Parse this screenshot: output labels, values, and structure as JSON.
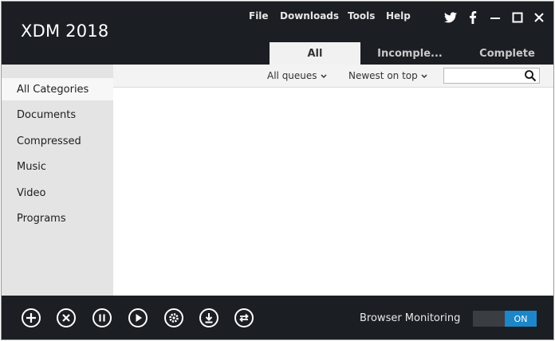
{
  "app": {
    "title": "XDM 2018"
  },
  "menu": {
    "file": "File",
    "downloads": "Downloads",
    "tools": "Tools",
    "help": "Help"
  },
  "window_controls": [
    "twitter-icon",
    "facebook-icon",
    "minimize-icon",
    "maximize-icon",
    "close-icon"
  ],
  "tabs": [
    {
      "label": "All",
      "active": true
    },
    {
      "label": "Incomple...",
      "active": false
    },
    {
      "label": "Complete",
      "active": false
    }
  ],
  "sidebar": {
    "categories": [
      {
        "label": "All Categories",
        "selected": true
      },
      {
        "label": "Documents",
        "selected": false
      },
      {
        "label": "Compressed",
        "selected": false
      },
      {
        "label": "Music",
        "selected": false
      },
      {
        "label": "Video",
        "selected": false
      },
      {
        "label": "Programs",
        "selected": false
      }
    ]
  },
  "filters": {
    "queue": "All queues",
    "sort": "Newest on top",
    "search_value": ""
  },
  "toolbar": {
    "icons": [
      "add-icon",
      "cancel-icon",
      "pause-icon",
      "resume-icon",
      "settings-icon",
      "download-icon",
      "convert-icon"
    ],
    "browser_monitoring_label": "Browser Monitoring",
    "toggle_state": "ON"
  },
  "colors": {
    "header_bg": "#1b1e23",
    "sidebar_bg": "#e4e4e4",
    "accent": "#1c86c8"
  }
}
